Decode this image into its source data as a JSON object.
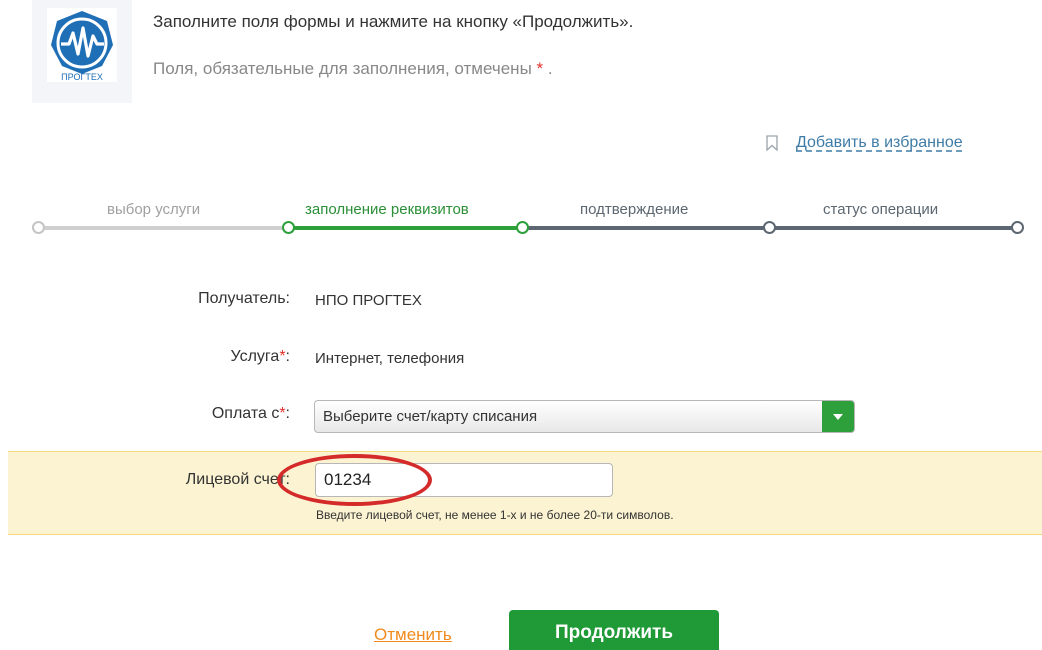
{
  "header": {
    "logo_text": "ПРОГТЕХ",
    "instruction": "Заполните поля формы и нажмите на кнопку «Продолжить».",
    "required_note": "Поля, обязательные для заполнения, отмечены",
    "required_star": "*",
    "required_end": "."
  },
  "favorites": {
    "icon": "bookmark-icon",
    "label": "Добавить в избранное"
  },
  "steps": [
    {
      "label": "выбор услуги",
      "state": "done"
    },
    {
      "label": "заполнение реквизитов",
      "state": "active"
    },
    {
      "label": "подтверждение",
      "state": "todo"
    },
    {
      "label": "статус операции",
      "state": "todo"
    }
  ],
  "form": {
    "recipient": {
      "label": "Получатель:",
      "value": "НПО ПРОГТЕХ"
    },
    "service": {
      "label": "Услуга",
      "star": "*",
      "colon": ":",
      "value": "Интернет, телефония"
    },
    "payment": {
      "label": "Оплата с",
      "star": "*",
      "colon": ":",
      "selected": "Выберите счет/карту списания"
    },
    "account": {
      "label": "Лицевой счет:",
      "value": "01234",
      "hint": "Введите лицевой счет, не менее 1-х и не более 20-ти символов."
    }
  },
  "actions": {
    "cancel": "Отменить",
    "continue": "Продолжить"
  },
  "colors": {
    "accent_green": "#1f9a37",
    "link_blue": "#3e7ca7",
    "cancel_orange": "#f08a1c",
    "required_red": "#e0302b",
    "highlight_bg": "#fbf3d1",
    "annotation_red": "#d42a2a"
  }
}
